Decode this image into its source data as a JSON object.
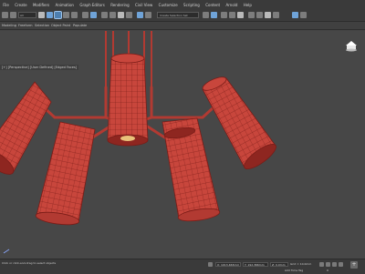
{
  "menu": [
    "File",
    "Create",
    "Modifiers",
    "Animation",
    "Graph Editors",
    "Rendering",
    "Civil View",
    "Customize",
    "Scripting",
    "Content",
    "Arnold",
    "Help"
  ],
  "toolbar": {
    "selection_filter": "All",
    "named_selection": "Create Selection Set"
  },
  "ribbon": {
    "tabs": [
      "Modeling",
      "Freeform",
      "Selection",
      "Object Paint",
      "Populate"
    ]
  },
  "viewport": {
    "label": "[+] [Perspective] [User Defined] [Edged Faces]",
    "object_color": "#c8463c",
    "edge_color": "#7a1c17",
    "background": "#474747"
  },
  "status": {
    "left": "Click or click-and-drag to select objects",
    "x_field": "X: 1013.463mm",
    "y_field": "Y: 192.366mm",
    "z_field": "Z: 0.0mm",
    "grid": "Grid = 10.0mm",
    "add_time_tag": "Add Time Tag",
    "frame": "0"
  }
}
